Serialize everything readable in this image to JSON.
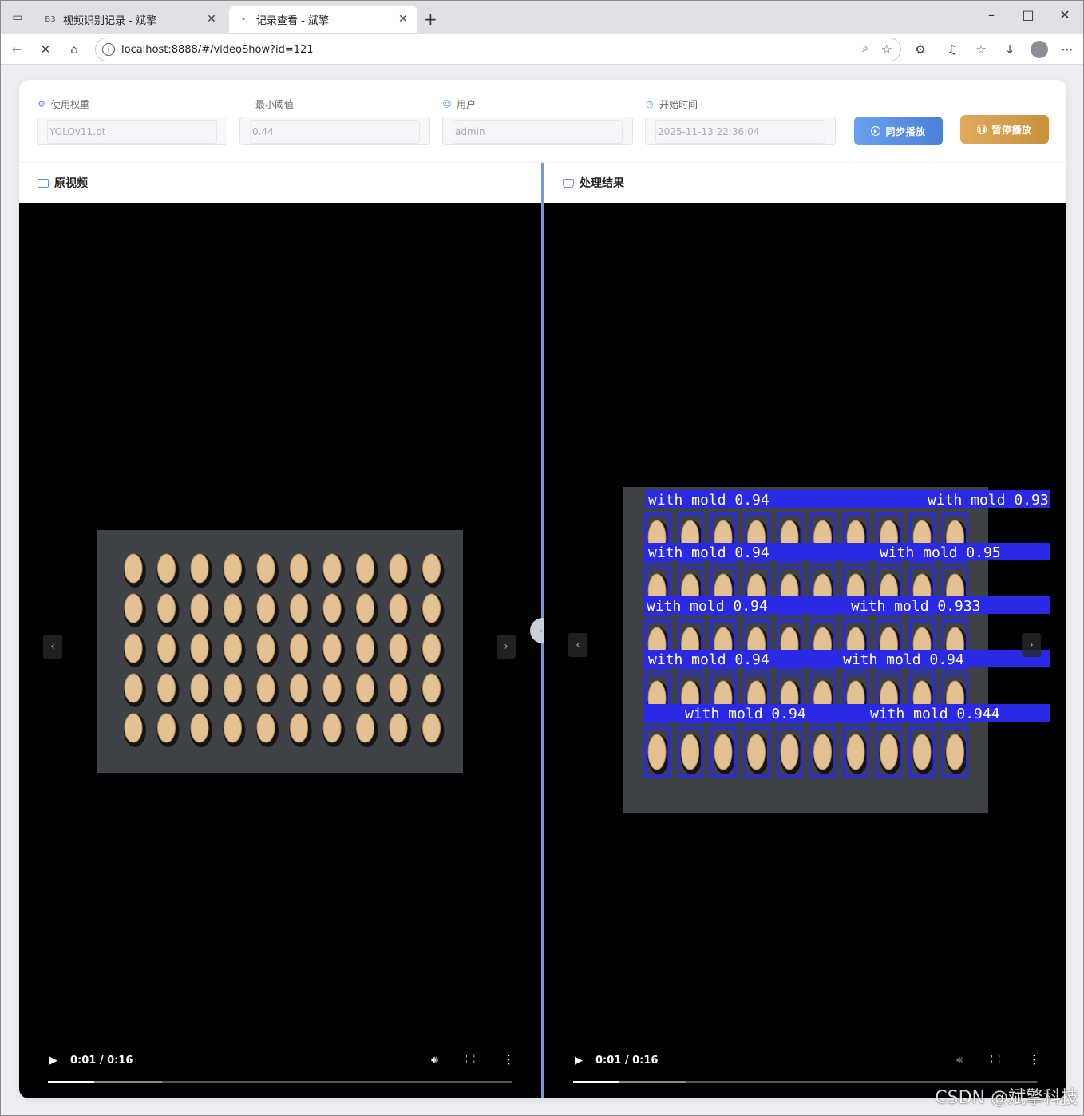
{
  "browser": {
    "tabs": [
      {
        "title": "视频识别记录 - 斌擎",
        "favicon": "B3"
      },
      {
        "title": "记录查看 - 斌擎",
        "favicon": "•"
      }
    ],
    "url": "localhost:8888/#/videoShow?id=121"
  },
  "form": {
    "weight_label": "使用权重",
    "weight_value": "YOLOv11.pt",
    "threshold_label": "最小阈值",
    "threshold_value": "0.44",
    "user_label": "用户",
    "user_value": "admin",
    "start_label": "开始时间",
    "start_value": "2025-11-13 22:36:04"
  },
  "buttons": {
    "sync": "同步播放",
    "pause": "暂停播放"
  },
  "panels": {
    "original_title": "原视频",
    "result_title": "处理结果"
  },
  "video": {
    "left_time": "0:01 / 0:16",
    "right_time": "0:01 / 0:16",
    "left_progress": 0.1,
    "left_buffered": 0.245,
    "right_progress": 0.1,
    "right_buffered": 0.243
  },
  "detections": {
    "labels": [
      "with mold 0.94",
      "with mold 0.93",
      "with mold 0.95",
      "with mold 0.93",
      "with mold 0.94",
      "with mold 0.933",
      "with mold 0.94",
      "with mold 0.94",
      "with mold 0.944"
    ]
  },
  "watermark": "CSDN @斌擎科技",
  "colors": {
    "accent": "#5b8ff2",
    "sync": "#4c80d8",
    "pause": "#c9913d",
    "box": "#2a2ae6"
  }
}
